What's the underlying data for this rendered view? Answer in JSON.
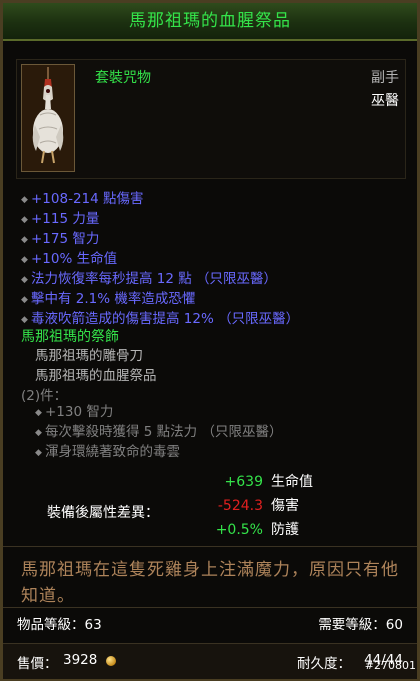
{
  "item": {
    "name": "馬那祖瑪的血腥祭品",
    "type": "套裝咒物",
    "slot": "副手",
    "class_restriction": "巫醫"
  },
  "affixes": [
    "+108-214 點傷害",
    "+115 力量",
    "+175 智力",
    "+10% 生命值",
    "法力恢復率每秒提高 12 點 （只限巫醫）",
    "擊中有 2.1% 機率造成恐懼",
    "毒液吹箭造成的傷害提高 12% （只限巫醫）"
  ],
  "set": {
    "name": "馬那祖瑪的祭飾",
    "items": [
      "馬那祖瑪的雕骨刀",
      "馬那祖瑪的血腥祭品"
    ],
    "bonus_label": "(2)件：",
    "bonuses": [
      "+130 智力",
      "每次擊殺時獲得 5 點法力 （只限巫醫）",
      "渾身環繞著致命的毒雲"
    ]
  },
  "comparison": {
    "label": "裝備後屬性差異：",
    "rows": [
      {
        "value": "+639",
        "name": "生命值",
        "color": "#34e34a"
      },
      {
        "value": "-524.3",
        "name": "傷害",
        "color": "#e02020"
      },
      {
        "value": "+0.5%",
        "name": "防護",
        "color": "#34e34a"
      }
    ]
  },
  "flavor": "馬那祖瑪在這隻死雞身上注滿魔力，原因只有他知道。",
  "item_level": "物品等級：63",
  "required_level": "需要等級：60",
  "price_label": "售價：",
  "price": "3928",
  "durability_label": "耐久度：",
  "durability": "44/44",
  "item_id": "#270801",
  "colors": {
    "title": "#34e34a",
    "magic_affix": "#6969ff",
    "set_inactive": "#808080",
    "flavor": "#ad835a"
  }
}
